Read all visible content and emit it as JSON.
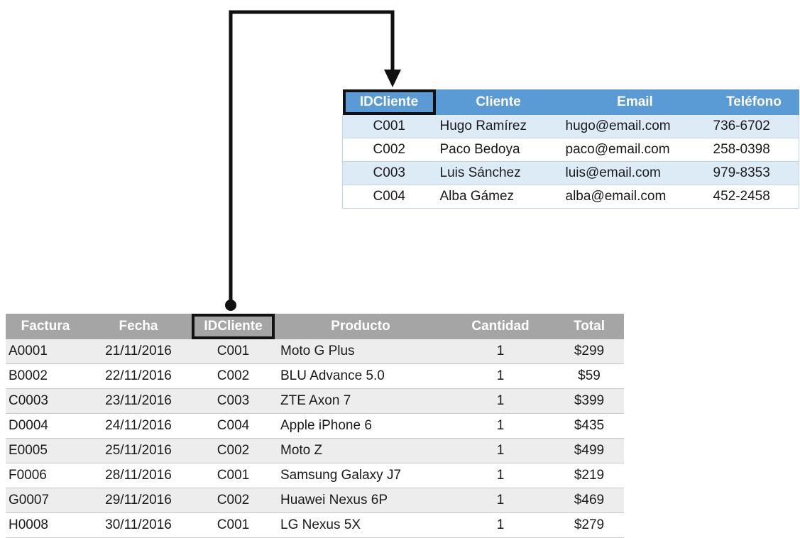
{
  "clients": {
    "headers": [
      "IDCliente",
      "Cliente",
      "Email",
      "Teléfono"
    ],
    "rows": [
      {
        "id": "C001",
        "name": "Hugo Ramírez",
        "email": "hugo@email.com",
        "phone": "736-6702"
      },
      {
        "id": "C002",
        "name": "Paco Bedoya",
        "email": "paco@email.com",
        "phone": "258-0398"
      },
      {
        "id": "C003",
        "name": "Luis Sánchez",
        "email": "luis@email.com",
        "phone": "979-8353"
      },
      {
        "id": "C004",
        "name": "Alba Gámez",
        "email": "alba@email.com",
        "phone": "452-2458"
      }
    ]
  },
  "invoices": {
    "headers": [
      "Factura",
      "Fecha",
      "IDCliente",
      "Producto",
      "Cantidad",
      "Total"
    ],
    "rows": [
      {
        "factura": "A0001",
        "fecha": "21/11/2016",
        "id": "C001",
        "producto": "Moto G Plus",
        "cantidad": "1",
        "total": "$299"
      },
      {
        "factura": "B0002",
        "fecha": "22/11/2016",
        "id": "C002",
        "producto": "BLU Advance 5.0",
        "cantidad": "1",
        "total": "$59"
      },
      {
        "factura": "C0003",
        "fecha": "23/11/2016",
        "id": "C003",
        "producto": "ZTE Axon 7",
        "cantidad": "1",
        "total": "$399"
      },
      {
        "factura": "D0004",
        "fecha": "24/11/2016",
        "id": "C004",
        "producto": "Apple iPhone 6",
        "cantidad": "1",
        "total": "$435"
      },
      {
        "factura": "E0005",
        "fecha": "25/11/2016",
        "id": "C002",
        "producto": "Moto Z",
        "cantidad": "1",
        "total": "$499"
      },
      {
        "factura": "F0006",
        "fecha": "28/11/2016",
        "id": "C001",
        "producto": "Samsung Galaxy J7",
        "cantidad": "1",
        "total": "$219"
      },
      {
        "factura": "G0007",
        "fecha": "29/11/2016",
        "id": "C002",
        "producto": "Huawei Nexus 6P",
        "cantidad": "1",
        "total": "$469"
      },
      {
        "factura": "H0008",
        "fecha": "30/11/2016",
        "id": "C001",
        "producto": "LG Nexus 5X",
        "cantidad": "1",
        "total": "$279"
      }
    ]
  },
  "colors": {
    "clients_header": "#5b9bd5",
    "clients_band": "#ddebf7",
    "invoices_header": "#a5a5a5",
    "invoices_band": "#ededed",
    "connector": "#111111"
  },
  "icons": [
    "arrow-down-icon",
    "connector-dot-icon"
  ]
}
